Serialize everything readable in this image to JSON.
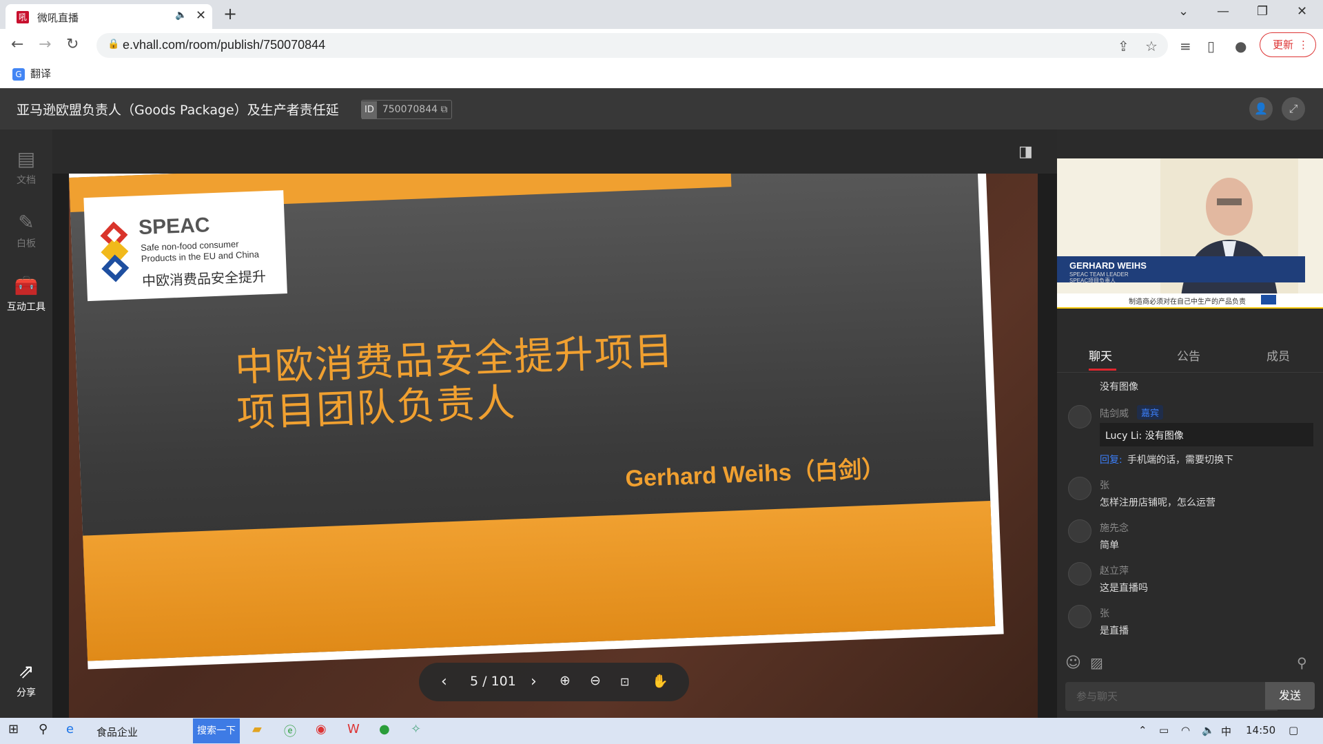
{
  "browser": {
    "tab_title": "微吼直播",
    "url": "e.vhall.com/room/publish/750070844",
    "update_label": "更新",
    "bookmark_translate": "翻译"
  },
  "room": {
    "title": "亚马逊欧盟负责人（Goods Package）及生产者责任延",
    "id_tag": "ID",
    "id_value": "750070844"
  },
  "rail": {
    "doc": "文档",
    "whiteboard": "白板",
    "tools": "互动工具",
    "share": "分享"
  },
  "slide": {
    "logo_name": "SPEAC",
    "logo_sub1": "Safe non-food consumer",
    "logo_sub2": "Products in the EU and China",
    "logo_cn": "中欧消费品安全提升",
    "title1": "中欧消费品安全提升项目",
    "title2": "项目团队负责人",
    "author": "Gerhard Weihs（白剑）"
  },
  "pager": {
    "page": "5 / 101"
  },
  "video": {
    "name": "GERHARD WEIHS",
    "role1": "SPEAC TEAM LEADER",
    "role2": "SPEAC项目负责人",
    "bottom_text": "制造商必须对在自己中生产的产品负责"
  },
  "chat": {
    "tabs": [
      "聊天",
      "公告",
      "成员"
    ],
    "messages": [
      {
        "user": "",
        "text": "没有图像"
      },
      {
        "user": "陆剑威",
        "tag": "嘉宾",
        "quote": "Lucy Li: 没有图像",
        "reply_label": "回复:",
        "text": "手机端的话，需要切换下"
      },
      {
        "user": "张",
        "text": "怎样注册店铺呢，怎么运营"
      },
      {
        "user": "施先念",
        "text": "简单"
      },
      {
        "user": "赵立萍",
        "text": "这是直播吗"
      },
      {
        "user": "张",
        "text": "是直播"
      }
    ],
    "input_placeholder": "参与聊天",
    "send_label": "发送"
  },
  "taskbar": {
    "ie_label": "食品企业",
    "search_label": "搜索一下",
    "ime": "中",
    "time": "14:50"
  }
}
